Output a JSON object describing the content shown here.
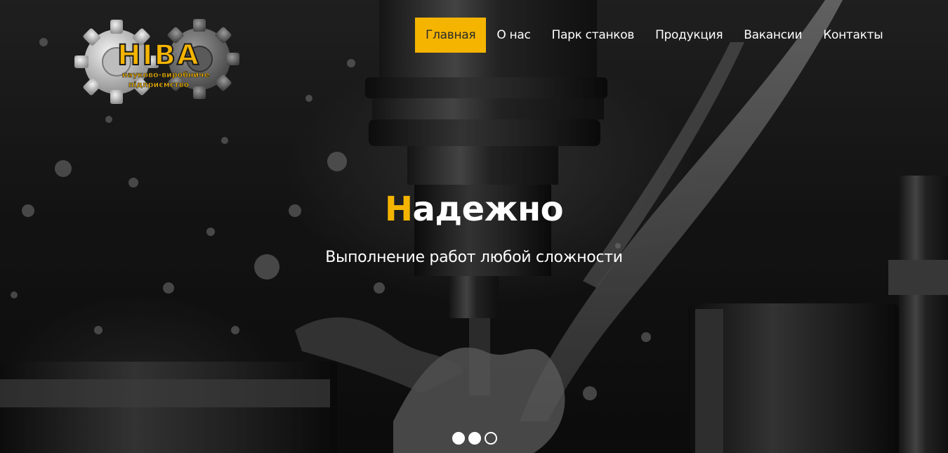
{
  "logo": {
    "name": "НІВА",
    "tagline_line1": "науково-виробниче",
    "tagline_line2": "підприємство"
  },
  "nav": {
    "items": [
      {
        "label": "Главная",
        "active": true
      },
      {
        "label": "О нас",
        "active": false
      },
      {
        "label": "Парк станков",
        "active": false
      },
      {
        "label": "Продукция",
        "active": false
      },
      {
        "label": "Вакансии",
        "active": false
      },
      {
        "label": "Контакты",
        "active": false
      }
    ]
  },
  "slide": {
    "headline_first_letter": "Н",
    "headline_rest": "адежно",
    "subtitle": "Выполнение работ любой сложности"
  },
  "carousel": {
    "slides_total": 3,
    "dot_states": [
      "filled",
      "filled",
      "outline"
    ]
  },
  "colors": {
    "accent": "#f4b400",
    "text": "#ffffff",
    "background": "#1a1a1a"
  }
}
